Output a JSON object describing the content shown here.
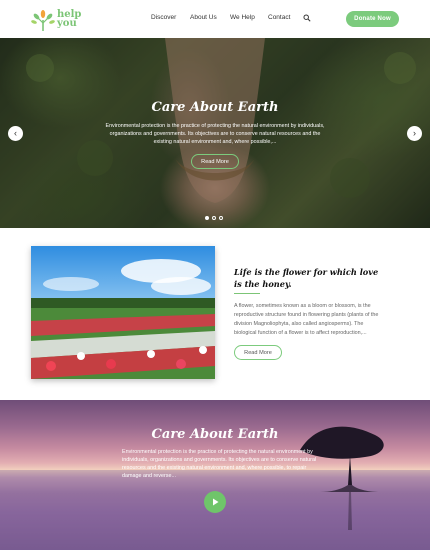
{
  "header": {
    "logo_line1": "help",
    "logo_line2": "you",
    "nav": [
      "Discover",
      "About Us",
      "We Help",
      "Contact"
    ],
    "donate_label": "Donate Now"
  },
  "hero": {
    "title": "Care About Earth",
    "text": "Environmental protection is the practice of protecting the natural environment by individuals, organizations and governments. Its objectives are to conserve natural resources and the existing natural environment and, where possible,...",
    "button_label": "Read More",
    "prev_icon": "chevron-left-icon",
    "next_icon": "chevron-right-icon",
    "slides_total": 3,
    "active_slide": 1
  },
  "feature": {
    "title": "Life is the flower for which love is the honey.",
    "text": "A flower, sometimes known as a bloom or blossom, is the reproductive structure found in flowering plants (plants of the division Magnoliophyta, also called angiosperms). The biological function of a flower is to affect reproduction,...",
    "button_label": "Read More"
  },
  "video": {
    "title": "Care About Earth",
    "text": "Environmental protection is the practice of protecting the natural environment by individuals, organizations and governments. Its objectives are to conserve natural resources and the existing natural environment and, where possible, to repair damage and reverse...",
    "play_icon": "play-icon"
  },
  "colors": {
    "accent": "#7ccb7d",
    "text_dark": "#333333"
  }
}
